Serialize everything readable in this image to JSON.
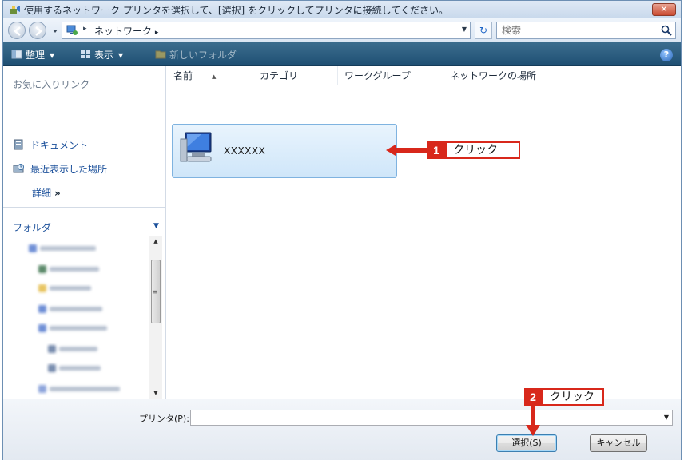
{
  "titlebar": {
    "title": "使用するネットワーク プリンタを選択して、[選択] をクリックしてプリンタに接続してください。",
    "close_label": "✕"
  },
  "address": {
    "breadcrumb_sep": "▸",
    "location": "ネットワーク",
    "trailing_sep": "▸",
    "search_placeholder": "検索"
  },
  "toolbar": {
    "organize": "整理",
    "views": "表示",
    "new_folder": "新しいフォルダ"
  },
  "sidebar": {
    "favorites_title": "お気に入りリンク",
    "items": [
      {
        "label": "ドキュメント",
        "icon": "documents-icon"
      },
      {
        "label": "最近表示した場所",
        "icon": "recent-places-icon"
      }
    ],
    "more_label": "詳細",
    "more_chevron": "»",
    "folders_label": "フォルダ"
  },
  "columns": [
    "名前",
    "カテゴリ",
    "ワークグループ",
    "ネットワークの場所"
  ],
  "items": [
    {
      "label": "XXXXXX",
      "icon": "network-computer-icon"
    }
  ],
  "callouts": [
    {
      "number": "1",
      "text": "クリック"
    },
    {
      "number": "2",
      "text": "クリック"
    }
  ],
  "bottom": {
    "printer_label": "プリンタ(P):",
    "printer_value": "",
    "select_button": "選択(S)",
    "cancel_button": "キャンセル"
  },
  "colors": {
    "callout_red": "#d8281b",
    "command_bar": "#2a5b7e",
    "selection": "#cfe6f9"
  }
}
